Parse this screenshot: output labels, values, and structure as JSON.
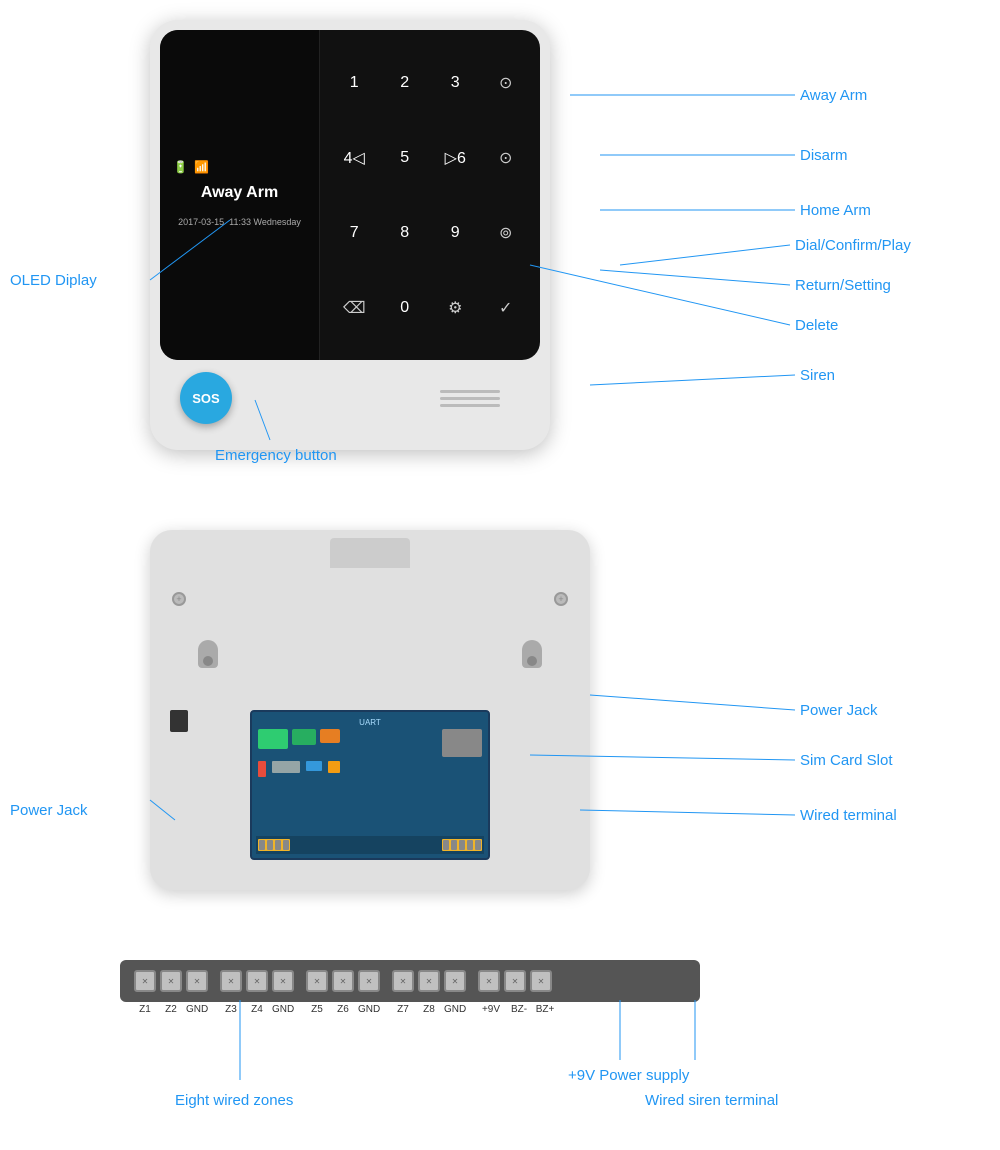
{
  "front_panel": {
    "oled": {
      "label": "Away Arm",
      "date": "2017-03-15",
      "time": "11:33",
      "day": "Wednesday",
      "battery_icon": "🔋",
      "wifi_icon": "📶"
    },
    "keypad": {
      "keys": [
        "1",
        "2",
        "3",
        "⊙",
        "4◁",
        "5",
        "▷6",
        "⊙",
        "7",
        "8",
        "9",
        "⊙",
        "⌫",
        "0",
        "⚙",
        "✓"
      ]
    },
    "sos_label": "SOS",
    "annotations": {
      "oled_display": "OLED Diplay",
      "away_arm": "Away Arm",
      "disarm": "Disarm",
      "home_arm": "Home Arm",
      "dial_confirm": "Dial/Confirm/Play",
      "return_setting": "Return/Setting",
      "delete": "Delete",
      "siren": "Siren",
      "emergency_button": "Emergency button"
    }
  },
  "back_panel": {
    "annotations": {
      "power_jack_right": "Power Jack",
      "sim_card_slot": "Sim Card Slot",
      "wired_terminal": "Wired terminal",
      "power_jack_left": "Power Jack"
    },
    "pcb": {
      "uart_label": "UART"
    }
  },
  "terminal_strip": {
    "labels": [
      "Z1",
      "Z2",
      "GND",
      "Z3",
      "Z4",
      "GND",
      "Z5",
      "Z6",
      "GND",
      "Z7",
      "Z8",
      "GND",
      "+9V",
      "BZ-",
      "BZ+"
    ],
    "annotations": {
      "eight_wired_zones": "Eight wired zones",
      "power_supply": "+9V Power supply",
      "wired_siren": "Wired siren terminal"
    }
  }
}
